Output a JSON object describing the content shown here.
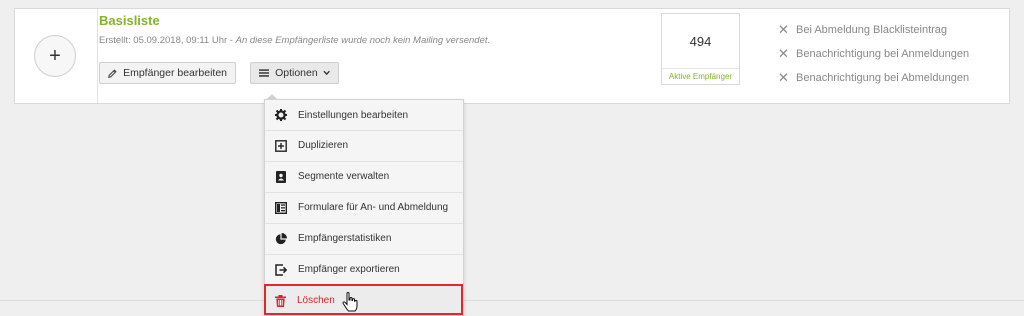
{
  "list": {
    "add_label": "+",
    "title": "Basisliste",
    "created": "Erstellt: 05.09.2018, 09:11 Uhr",
    "separator": " - ",
    "note": "An diese Empfängerliste wurde noch kein Mailing versendet."
  },
  "buttons": {
    "edit_recipients": "Empfänger bearbeiten",
    "options": "Optionen"
  },
  "counter": {
    "value": "494",
    "label": "Aktive Empfänger"
  },
  "settings": [
    {
      "label": "Bei Abmeldung Blacklisteintrag",
      "icon": "x-icon"
    },
    {
      "label": "Benachrichtigung bei Anmeldungen",
      "icon": "x-icon"
    },
    {
      "label": "Benachrichtigung bei Abmeldungen",
      "icon": "x-icon"
    }
  ],
  "menu": {
    "items": [
      {
        "label": "Einstellungen bearbeiten",
        "icon": "gear-icon"
      },
      {
        "label": "Duplizieren",
        "icon": "duplicate-icon"
      },
      {
        "label": "Segmente verwalten",
        "icon": "contacts-book-icon"
      },
      {
        "label": "Formulare für An- und Abmeldung",
        "icon": "form-layout-icon"
      },
      {
        "label": "Empfängerstatistiken",
        "icon": "pie-chart-icon"
      },
      {
        "label": "Empfänger exportieren",
        "icon": "export-icon"
      },
      {
        "label": "Löschen",
        "icon": "trash-icon"
      }
    ]
  },
  "colors": {
    "accent_green": "#86b32a",
    "danger_red": "#d9252b",
    "highlight_red": "#e0282f"
  }
}
